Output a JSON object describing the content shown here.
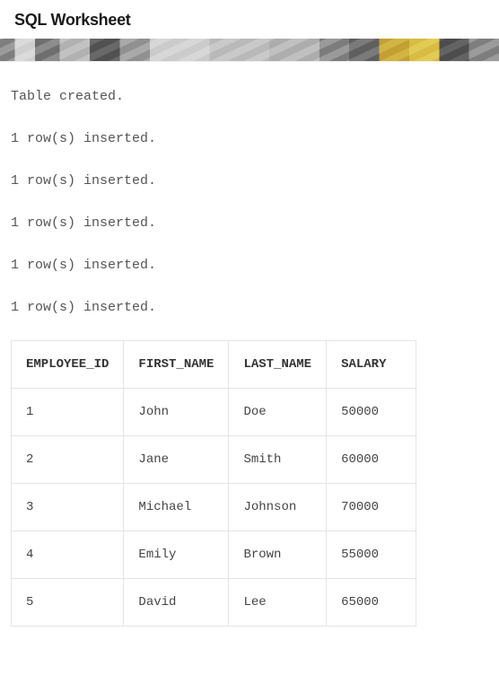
{
  "header": {
    "title": "SQL Worksheet"
  },
  "output": {
    "messages": [
      "Table created.",
      "1 row(s) inserted.",
      "1 row(s) inserted.",
      "1 row(s) inserted.",
      "1 row(s) inserted.",
      "1 row(s) inserted."
    ],
    "table": {
      "headers": [
        "EMPLOYEE_ID",
        "FIRST_NAME",
        "LAST_NAME",
        "SALARY"
      ],
      "rows": [
        [
          "1",
          "John",
          "Doe",
          "50000"
        ],
        [
          "2",
          "Jane",
          "Smith",
          "60000"
        ],
        [
          "3",
          "Michael",
          "Johnson",
          "70000"
        ],
        [
          "4",
          "Emily",
          "Brown",
          "55000"
        ],
        [
          "5",
          "David",
          "Lee",
          "65000"
        ]
      ]
    }
  }
}
